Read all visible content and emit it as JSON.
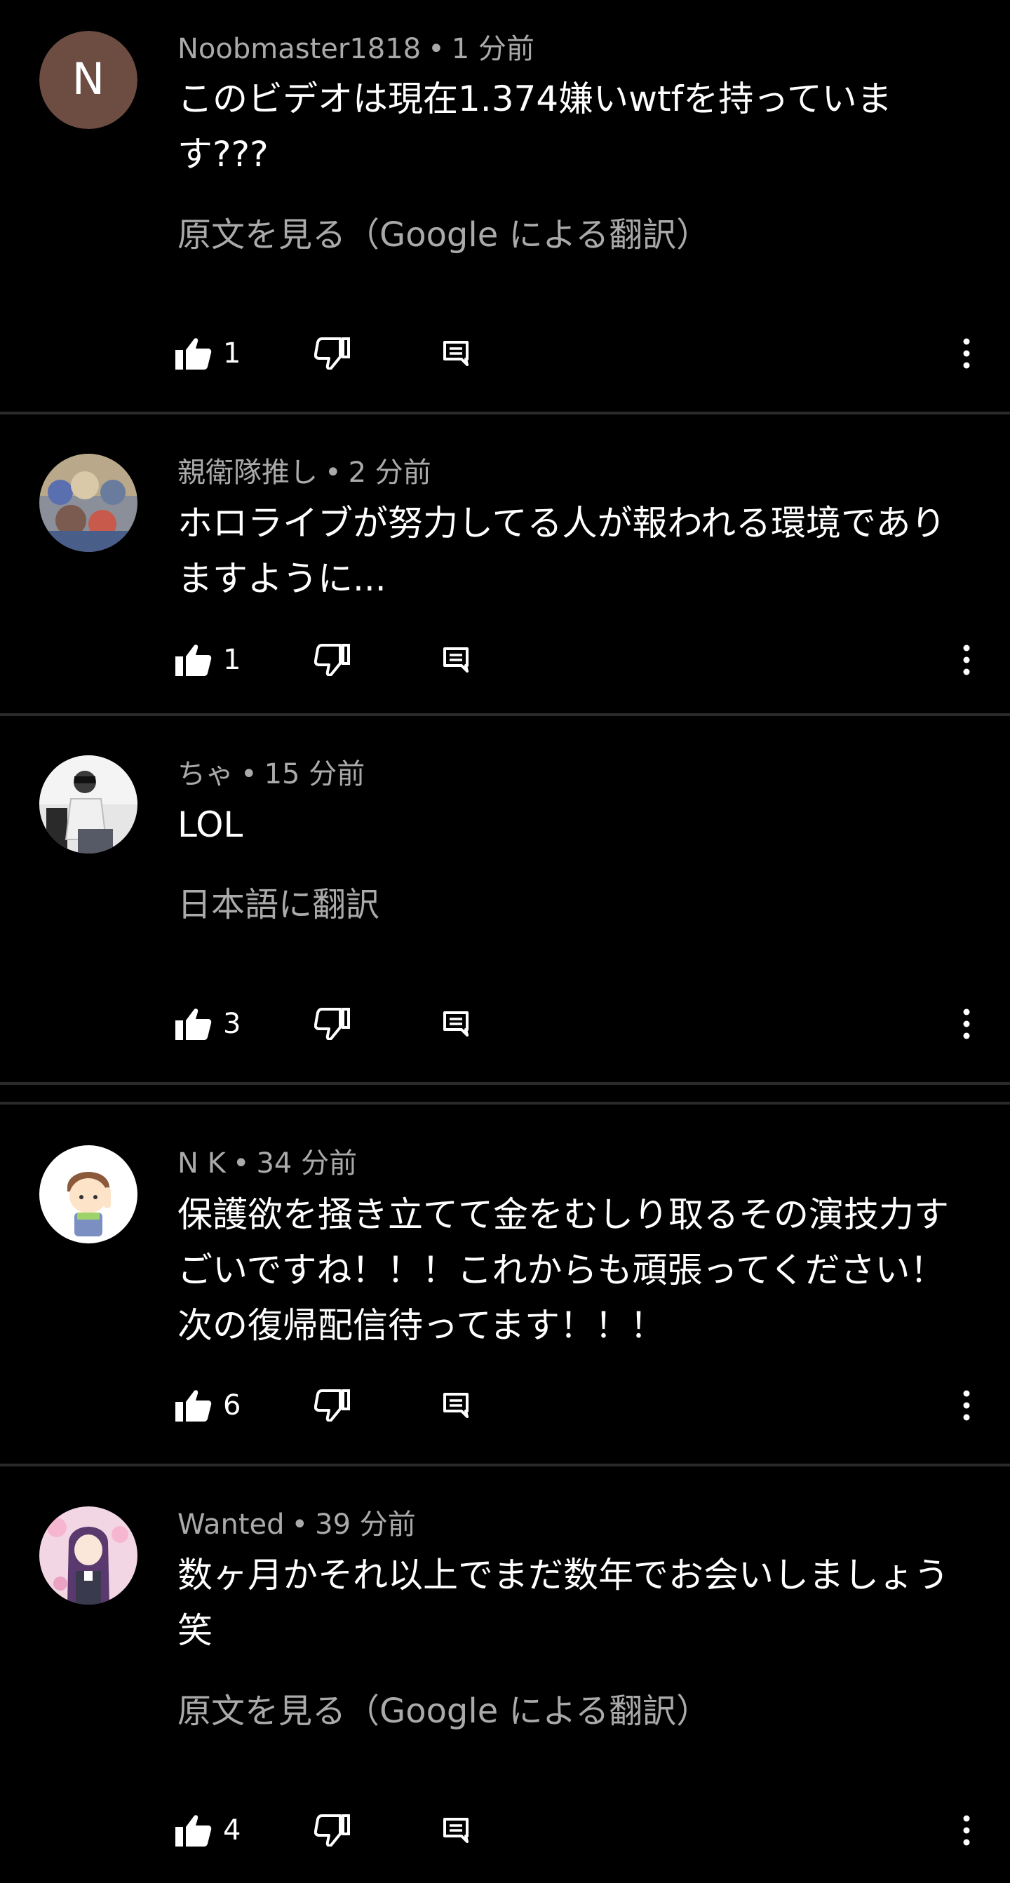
{
  "colors": {
    "background": "#000000",
    "text_primary": "#ffffff",
    "text_secondary": "#aaaaaa",
    "divider": "#2a2a2a"
  },
  "comments": [
    {
      "avatar_letter": "N",
      "avatar_color": "#6d4c41",
      "author": "Noobmaster1818",
      "time": "1 分前",
      "text": "このビデオは現在1.374嫌いwtfを持っていま\nす???",
      "translate_link": "原文を見る（Google による翻訳）",
      "likes": "1"
    },
    {
      "avatar_icon": "anime-group-icon",
      "author": "親衛隊推し",
      "time": "2 分前",
      "text": "ホロライブが努力してる人が報われる環境であり\nますように...",
      "likes": "1"
    },
    {
      "avatar_icon": "person-photo-icon",
      "author": "ちゃ",
      "time": "15 分前",
      "text": "LOL",
      "translate_link": "日本語に翻訳",
      "likes": "3"
    },
    {
      "avatar_icon": "cartoon-boy-icon",
      "author": "N K",
      "time": "34 分前",
      "text": "保護欲を掻き立てて金をむしり取るその演技力す\nごいですね！！！これからも頑張ってください！\n次の復帰配信待ってます！！！",
      "likes": "6"
    },
    {
      "avatar_icon": "anime-girl-icon",
      "author": "Wanted",
      "time": "39 分前",
      "text": "数ヶ月かそれ以上でまだ数年でお会いしましょう\n笑",
      "translate_link": "原文を見る（Google による翻訳）",
      "likes": "4"
    }
  ],
  "meta_separator": "•"
}
